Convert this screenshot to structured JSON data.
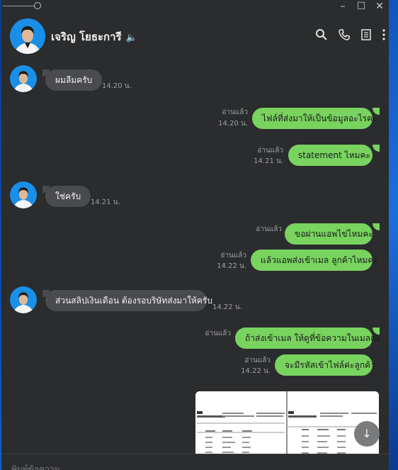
{
  "header": {
    "contact_name": "เจริญ โยธะการี"
  },
  "messages": [
    {
      "dir": "in",
      "text": "ผมลืมครับ",
      "time": "14.20 น."
    },
    {
      "dir": "out",
      "text": "ไฟล์ที่ส่งมาให้เป็นข้อมูลอะไรคะ",
      "read": "อ่านแล้ว",
      "time": "14.20 น."
    },
    {
      "dir": "out",
      "text": "statement ไหมคะ",
      "read": "อ่านแล้ว",
      "time": "14.21 น."
    },
    {
      "dir": "in",
      "text": "ใช่ครับ",
      "time": "14.21 น."
    },
    {
      "dir": "out",
      "text": "ขอผ่านแอพไข่ไหมคะ",
      "read": "อ่านแล้ว",
      "time": ""
    },
    {
      "dir": "out",
      "text": "แล้วแอพส่งเข้าเมล ลูกค้าไหมคะ",
      "read": "อ่านแล้ว",
      "time": "14.22 น."
    },
    {
      "dir": "in",
      "text": "ส่วนสลิปเงินเดือน ต้องรอบริษัทส่งมาให้ครับ",
      "time": "14.22 น."
    },
    {
      "dir": "out",
      "text": "ถ้าส่งเข้าเมล ให้ดูที่ข้อความในเมลค่ะ",
      "read": "อ่านแล้ว",
      "time": ""
    },
    {
      "dir": "out",
      "text": "จะมีรหัสเข้าไฟล์ค่ะลูกค้า",
      "read": "อ่านแล้ว",
      "time": "14.22 น."
    }
  ],
  "input": {
    "placeholder": "พิมพ์ข้อความ"
  },
  "colors": {
    "bubble_out": "#78d35f",
    "bubble_in": "#4a4b4e",
    "background": "#2b2c2e"
  },
  "icons": [
    "search-icon",
    "phone-icon",
    "notes-icon",
    "more-icon",
    "speaker-icon",
    "arrow-down-icon"
  ]
}
